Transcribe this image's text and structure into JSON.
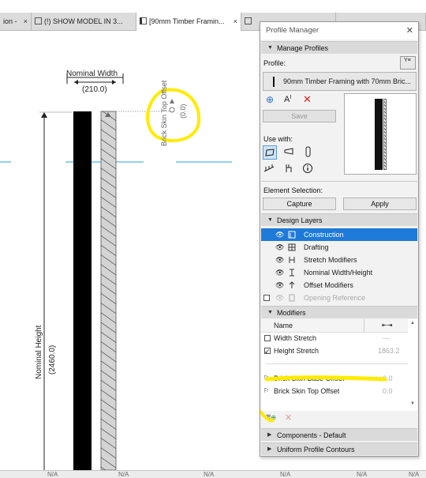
{
  "tabs": [
    {
      "label": "ion -",
      "active": false
    },
    {
      "label": "(!) SHOW MODEL IN 3...",
      "active": false
    },
    {
      "label": "[90mm Timber Framin...",
      "active": true
    },
    {
      "label": "",
      "active": false
    },
    {
      "label": "",
      "active": false
    }
  ],
  "canvas": {
    "nominal_width_label": "Nominal Width",
    "nominal_width_value": "(210.0)",
    "brick_top_offset_label": "Brick Skin Top Offset",
    "brick_top_offset_value": "(0.0)",
    "nominal_height_label": "Nominal Height",
    "nominal_height_value": "(2460.0)"
  },
  "palette": {
    "title": "Profile Manager",
    "manage_profiles": "Manage Profiles",
    "profile_label": "Profile:",
    "profile_value": "90mm Timber Framing with 70mm Bric...",
    "save": "Save",
    "use_with": "Use with:",
    "element_selection": "Element Selection:",
    "capture": "Capture",
    "apply": "Apply",
    "design_layers": "Design Layers",
    "layers": [
      {
        "label": "Construction",
        "selected": true,
        "dim": false
      },
      {
        "label": "Drafting",
        "selected": false,
        "dim": false
      },
      {
        "label": "Stretch Modifiers",
        "selected": false,
        "dim": false
      },
      {
        "label": "Nominal Width/Height",
        "selected": false,
        "dim": false
      },
      {
        "label": "Offset Modifiers",
        "selected": false,
        "dim": false
      },
      {
        "label": "Opening Reference",
        "selected": false,
        "dim": true
      }
    ],
    "modifiers": "Modifiers",
    "col_name": "Name",
    "modifier_rows": [
      {
        "label": "Width Stretch",
        "checked": false,
        "value": "---"
      },
      {
        "label": "Height Stretch",
        "checked": true,
        "value": "1863.2"
      }
    ],
    "offset_rows": [
      {
        "label": "Brick Skin Base Offset",
        "value": "0.0"
      },
      {
        "label": "Brick Skin Top Offset",
        "value": "0.0"
      }
    ],
    "components": "Components - Default",
    "uniform_contours": "Uniform Profile Contours"
  },
  "status": [
    "N/A",
    "N/A",
    "N/A",
    "N/A",
    "N/A",
    "N/A"
  ],
  "colors": {
    "highlight": "#ffeb00",
    "selection": "#1e7ad8",
    "guide": "#29a3e0"
  }
}
